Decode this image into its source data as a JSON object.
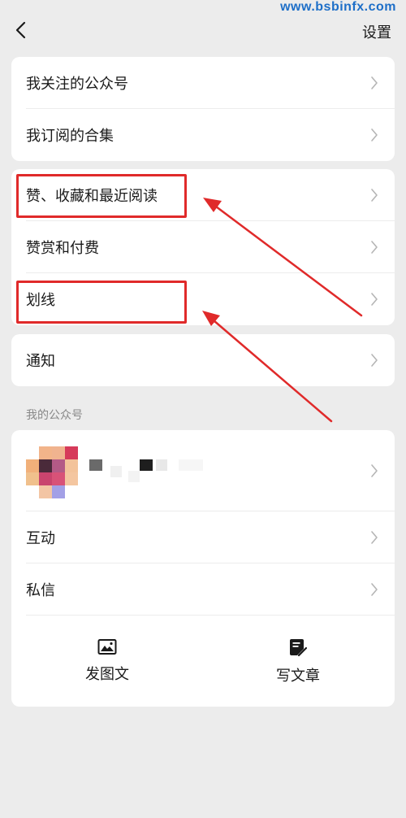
{
  "watermark": "www.bsbinfx.com",
  "header": {
    "title": "设置"
  },
  "group1": [
    {
      "label": "我关注的公众号"
    },
    {
      "label": "我订阅的合集"
    }
  ],
  "group2": [
    {
      "label": "赞、收藏和最近阅读"
    },
    {
      "label": "赞赏和付费"
    },
    {
      "label": "划线"
    }
  ],
  "group3": [
    {
      "label": "通知"
    }
  ],
  "my_account": {
    "section_label": "我的公众号",
    "rows": [
      {
        "label": "互动"
      },
      {
        "label": "私信"
      }
    ],
    "actions": {
      "post_image_label": "发图文",
      "write_article_label": "写文章"
    }
  },
  "colors": {
    "annotation_red": "#e02a2a",
    "background": "#ececec",
    "card": "#ffffff",
    "watermark": "#1e6fc8"
  },
  "icons": {
    "back": "chevron-left-icon",
    "row_chevron": "chevron-right-icon",
    "post_image": "image-icon",
    "write_article": "edit-document-icon"
  }
}
